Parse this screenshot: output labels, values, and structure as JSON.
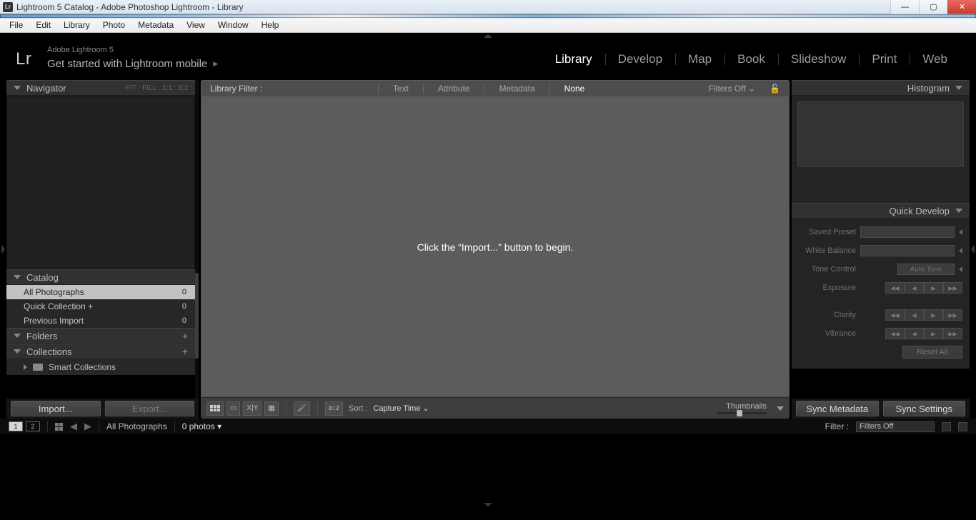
{
  "window": {
    "title": "Lightroom 5 Catalog - Adobe Photoshop Lightroom - Library"
  },
  "menubar": [
    "File",
    "Edit",
    "Library",
    "Photo",
    "Metadata",
    "View",
    "Window",
    "Help"
  ],
  "identity": {
    "logo": "Lr",
    "brand": "Adobe Lightroom 5",
    "getstarted": "Get started with Lightroom mobile"
  },
  "modules": [
    "Library",
    "Develop",
    "Map",
    "Book",
    "Slideshow",
    "Print",
    "Web"
  ],
  "active_module": "Library",
  "left": {
    "navigator": {
      "title": "Navigator",
      "zoom": [
        "FIT",
        "FILL",
        "1:1",
        "3:1"
      ]
    },
    "catalog": {
      "title": "Catalog",
      "items": [
        {
          "label": "All Photographs",
          "count": "0",
          "selected": true
        },
        {
          "label": "Quick Collection  +",
          "count": "0",
          "selected": false
        },
        {
          "label": "Previous Import",
          "count": "0",
          "selected": false
        }
      ]
    },
    "folders": {
      "title": "Folders"
    },
    "collections": {
      "title": "Collections",
      "smart": "Smart Collections"
    },
    "buttons": {
      "import": "Import...",
      "export": "Export..."
    }
  },
  "center": {
    "filterbar": {
      "label": "Library Filter :",
      "options": [
        "Text",
        "Attribute",
        "Metadata",
        "None"
      ],
      "active": "None",
      "preset": "Filters Off"
    },
    "hint": "Click the “Import...” button to begin.",
    "toolbar": {
      "sort_label": "Sort :",
      "sort_value": "Capture Time",
      "thumbs_label": "Thumbnails"
    }
  },
  "right": {
    "histogram": {
      "title": "Histogram"
    },
    "quickdev": {
      "title": "Quick Develop",
      "saved_preset": "Saved Preset",
      "white_balance": "White Balance",
      "tone_control": "Tone Control",
      "auto_tone": "Auto Tone",
      "exposure": "Exposure",
      "clarity": "Clarity",
      "vibrance": "Vibrance",
      "reset": "Reset All"
    },
    "buttons": {
      "sync_meta": "Sync Metadata",
      "sync_settings": "Sync Settings"
    }
  },
  "filmstrip": {
    "screens": [
      "1",
      "2"
    ],
    "crumb": "All Photographs",
    "count": "0 photos",
    "filter_label": "Filter :",
    "filter_value": "Filters Off"
  }
}
